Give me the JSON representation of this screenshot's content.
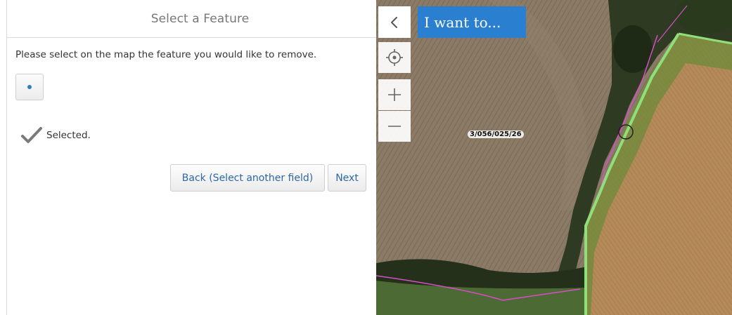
{
  "panel": {
    "title": "Select a Feature",
    "instruction": "Please select on the map the feature you would like to remove.",
    "tool": {
      "icon": "point-dot-icon"
    },
    "status": {
      "icon": "checkmark-icon",
      "text": "Selected."
    },
    "buttons": {
      "back": "Back (Select another field)",
      "next": "Next"
    }
  },
  "map": {
    "collapse_icon": "chevron-left-icon",
    "i_want_to": "I want to...",
    "controls": {
      "locate_icon": "crosshair-icon",
      "zoom_in_icon": "plus-icon",
      "zoom_out_icon": "minus-icon"
    },
    "parcel_label": "3/056/025/26",
    "colors": {
      "accent": "#2a7fd0",
      "parcel_boundary": "#8fe07a",
      "field_boundary": "#d64fc7"
    }
  }
}
